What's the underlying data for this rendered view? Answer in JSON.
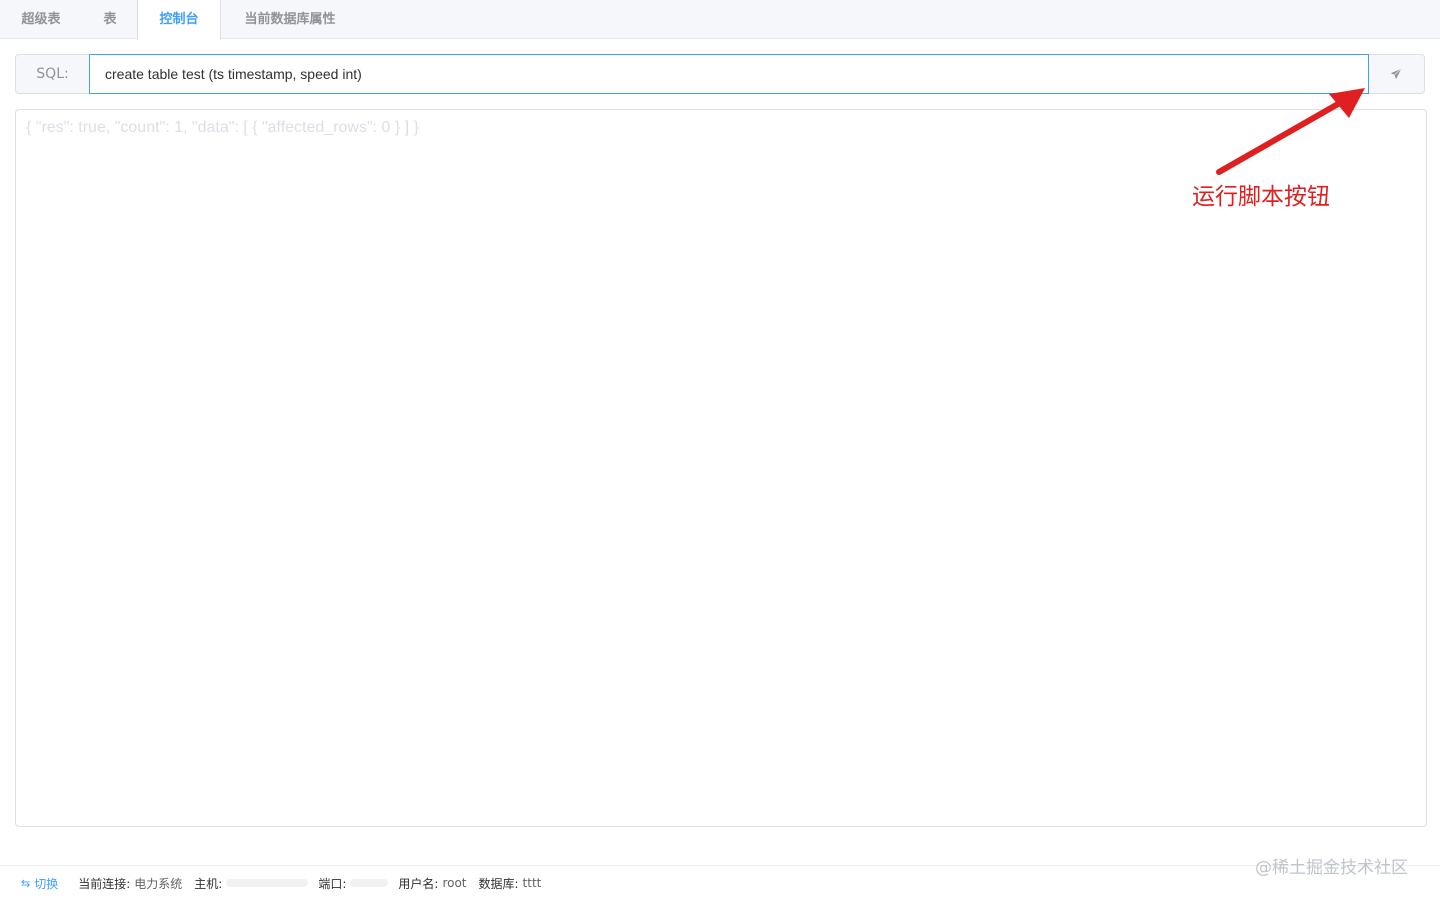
{
  "tabs": [
    {
      "label": "超级表",
      "active": false
    },
    {
      "label": "表",
      "active": false
    },
    {
      "label": "控制台",
      "active": true
    },
    {
      "label": "当前数据库属性",
      "active": false
    }
  ],
  "sql": {
    "prefix": "SQL:",
    "value": "create table test (ts timestamp, speed int)",
    "send_icon": "paper-plane-icon"
  },
  "result": {
    "text": "{ \"res\": true, \"count\": 1, \"data\": [ { \"affected_rows\": 0 } ] }"
  },
  "annotation": {
    "text": "运行脚本按钮",
    "color": "#e02020"
  },
  "footer": {
    "switch_label": "切换",
    "switch_icon": "swap-icon",
    "connection_label": "当前连接:",
    "connection_value": "电力系统",
    "host_label": "主机:",
    "port_label": "端口:",
    "user_label": "用户名:",
    "user_value": "root",
    "db_label": "数据库:",
    "db_value": "tttt"
  },
  "watermark": "@稀土掘金技术社区",
  "colors": {
    "accent": "#409eff",
    "border": "#dcdfe6",
    "tab_bg": "#f5f7fa"
  }
}
